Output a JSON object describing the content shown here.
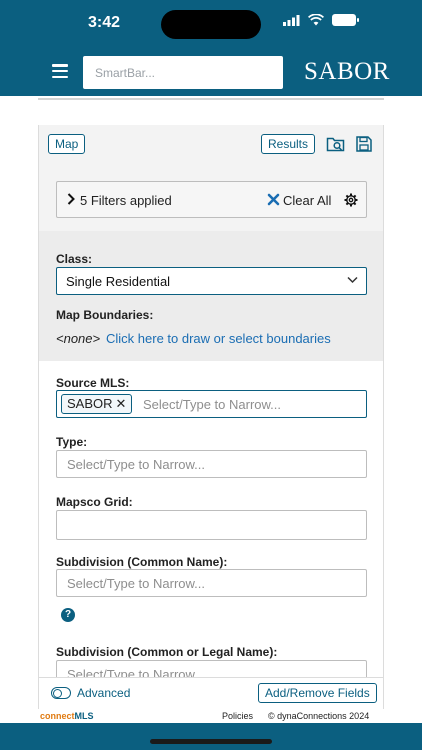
{
  "status": {
    "time": "3:42"
  },
  "header": {
    "smartbar_placeholder": "SmartBar...",
    "logo": "SABOR"
  },
  "toolbar": {
    "map_label": "Map",
    "results_label": "Results"
  },
  "filters": {
    "summary": "5 Filters applied",
    "clear_label": "Clear All"
  },
  "class_field": {
    "label": "Class:",
    "value": "Single Residential"
  },
  "map_boundaries": {
    "label": "Map Boundaries:",
    "none_text": "<none>",
    "link_text": "Click here to draw or select boundaries"
  },
  "source_mls": {
    "label": "Source MLS:",
    "chip": "SABOR",
    "placeholder": "Select/Type to Narrow..."
  },
  "type_field": {
    "label": "Type:",
    "placeholder": "Select/Type to Narrow..."
  },
  "mapsco_field": {
    "label": "Mapsco Grid:",
    "value": ""
  },
  "subdivision_common": {
    "label": "Subdivision (Common Name):",
    "placeholder": "Select/Type to Narrow..."
  },
  "subdivision_legal": {
    "label": "Subdivision (Common or Legal Name):",
    "placeholder": "Select/Type to Narrow..."
  },
  "bottom": {
    "advanced_label": "Advanced",
    "add_remove_label": "Add/Remove Fields"
  },
  "footer": {
    "brand_part1": "connect",
    "brand_part2": "MLS",
    "policies": "Policies",
    "copyright": "© dynaConnections 2024"
  },
  "colors": {
    "primary": "#0b5f80",
    "link": "#1a6db3",
    "brand_orange": "#e07b12"
  }
}
